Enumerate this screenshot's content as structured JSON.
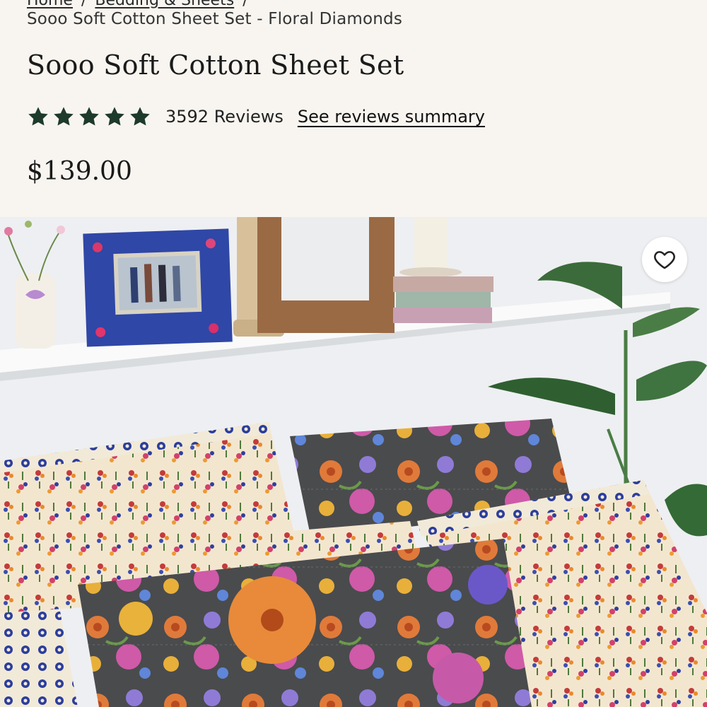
{
  "breadcrumb": {
    "items": [
      "Home",
      "Bedding & Sheets"
    ],
    "current": "Sooo Soft Cotton Sheet Set - Floral Diamonds"
  },
  "product": {
    "title": "Sooo Soft Cotton Sheet Set",
    "rating": 5,
    "reviews_count": "3592 Reviews",
    "reviews_link": "See reviews summary",
    "price": "$139.00"
  },
  "icons": {
    "star": "star-icon",
    "favorite": "heart-icon"
  },
  "colors": {
    "background": "#f8f5f0",
    "star": "#1e3a2a",
    "text": "#1c1c1c"
  }
}
